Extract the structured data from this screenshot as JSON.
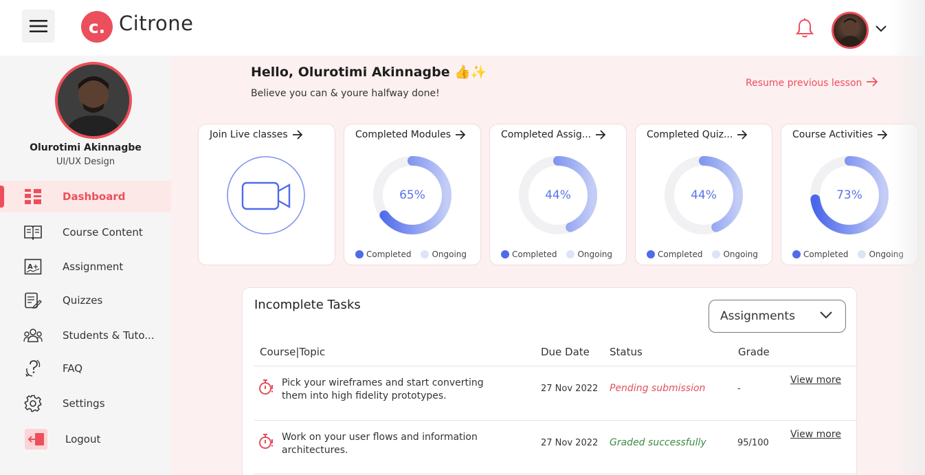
{
  "brand": {
    "logo_letter": "c.",
    "name": "Citrone",
    "accent": "#ec4f5c"
  },
  "header": {
    "menu_icon": "hamburger-icon",
    "notifications_icon": "bell-icon",
    "profile_menu_icon": "chevron-down-icon"
  },
  "profile": {
    "name": "Olurotimi Akinnagbe",
    "role": "UI/UX Design"
  },
  "sidebar": {
    "items": [
      {
        "label": "Dashboard",
        "icon": "dashboard-icon",
        "active": true
      },
      {
        "label": "Course Content",
        "icon": "book-icon"
      },
      {
        "label": "Assignment",
        "icon": "assignment-icon"
      },
      {
        "label": "Quizzes",
        "icon": "quiz-icon"
      },
      {
        "label": "Students & Tuto...",
        "icon": "people-icon"
      },
      {
        "label": "FAQ",
        "icon": "faq-icon"
      },
      {
        "label": "Settings",
        "icon": "gear-icon"
      },
      {
        "label": "Logout",
        "icon": "logout-icon"
      }
    ]
  },
  "greeting": {
    "title": "Hello, Olurotimi Akinnagbe 👍✨",
    "subtitle": "Believe you can & youre halfway done!",
    "resume_link": "Resume previous lesson"
  },
  "cards": [
    {
      "title": "Join Live classes",
      "icon": "video-camera-icon"
    },
    {
      "title": "Completed Modules",
      "percent_label": "65%",
      "completed_fraction": 0.65
    },
    {
      "title": "Completed Assig...",
      "percent_label": "44%",
      "completed_fraction": 0.44
    },
    {
      "title": "Completed Quiz...",
      "percent_label": "44%",
      "completed_fraction": 0.44
    },
    {
      "title": "Course Activities",
      "percent_label": "73%",
      "completed_fraction": 0.73
    }
  ],
  "legend": {
    "completed": "Completed",
    "ongoing": "Ongoing",
    "completed_color": "#4f6bea",
    "ongoing_color": "#dfe3f8"
  },
  "tasks": {
    "title": "Incomplete Tasks",
    "filter_value": "Assignments",
    "columns": {
      "topic": "Course|Topic",
      "due": "Due Date",
      "status": "Status",
      "grade": "Grade"
    },
    "rows": [
      {
        "topic": "Pick your wireframes and start converting them into high fidelity prototypes.",
        "due": "27 Nov 2022",
        "status": "Pending submission",
        "status_color": "#e0505a",
        "grade": "-",
        "action": "View more"
      },
      {
        "topic": "Work on your user flows and information architectures.",
        "due": "27 Nov 2022",
        "status": "Graded successfully",
        "status_color": "#3c8a45",
        "grade": "95/100",
        "action": "View more"
      }
    ]
  }
}
